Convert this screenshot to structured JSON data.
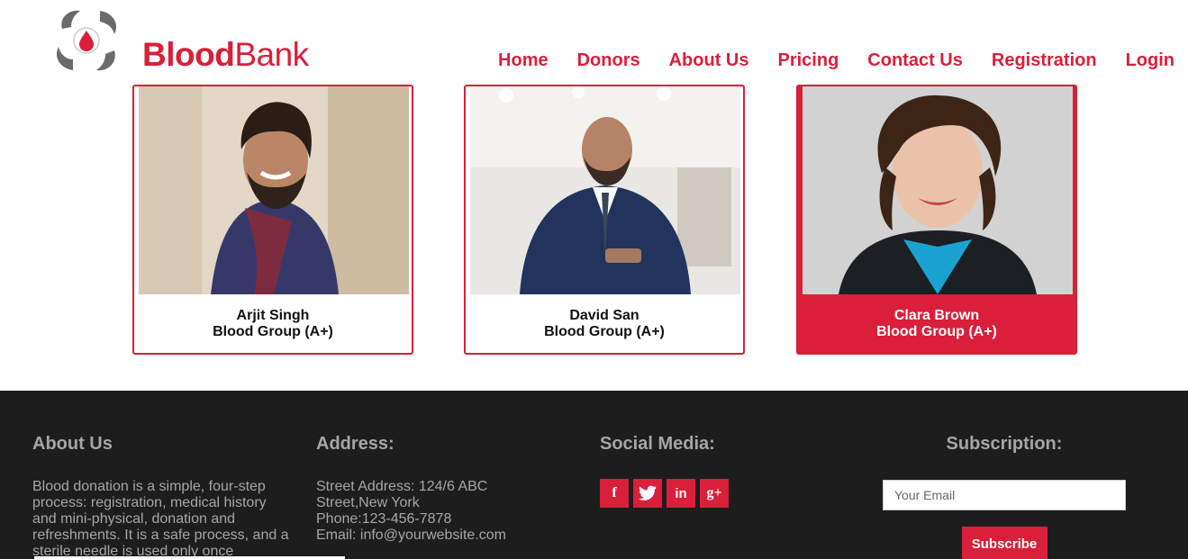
{
  "header": {
    "brand_bold": "Blood",
    "brand_light": "Bank",
    "logo_icon": "blood-drop-hands-icon",
    "nav": [
      "Home",
      "Donors",
      "About Us",
      "Pricing",
      "Contact Us",
      "Registration",
      "Login"
    ]
  },
  "donors": [
    {
      "name": "Arjit Singh",
      "group": "Blood Group (A+)",
      "active": false
    },
    {
      "name": "David San",
      "group": "Blood Group (A+)",
      "active": false
    },
    {
      "name": "Clara Brown",
      "group": "Blood Group (A+)",
      "active": true
    }
  ],
  "footer": {
    "about": {
      "title": "About Us",
      "text": "Blood donation is a simple, four-step process: registration, medical history and mini-physical, donation and refreshments. It is a safe process, and a sterile needle is used only once"
    },
    "address": {
      "title": "Address:",
      "line1": "Street Address: 124/6 ABC Street,New York",
      "line2": "Phone:123-456-7878",
      "line3": "Email: info@yourwebsite.com"
    },
    "social": {
      "title": "Social Media:",
      "icons": [
        "facebook-icon",
        "twitter-icon",
        "linkedin-icon",
        "google-plus-icon"
      ],
      "glyphs": [
        "f",
        "🐦",
        "in",
        "g+"
      ]
    },
    "subscription": {
      "title": "Subscription:",
      "placeholder": "Your Email",
      "button": "Subscribe"
    }
  },
  "colors": {
    "accent": "#d91f3a",
    "footer_bg": "#1d1d1d",
    "footer_text": "#a6a6a6"
  }
}
